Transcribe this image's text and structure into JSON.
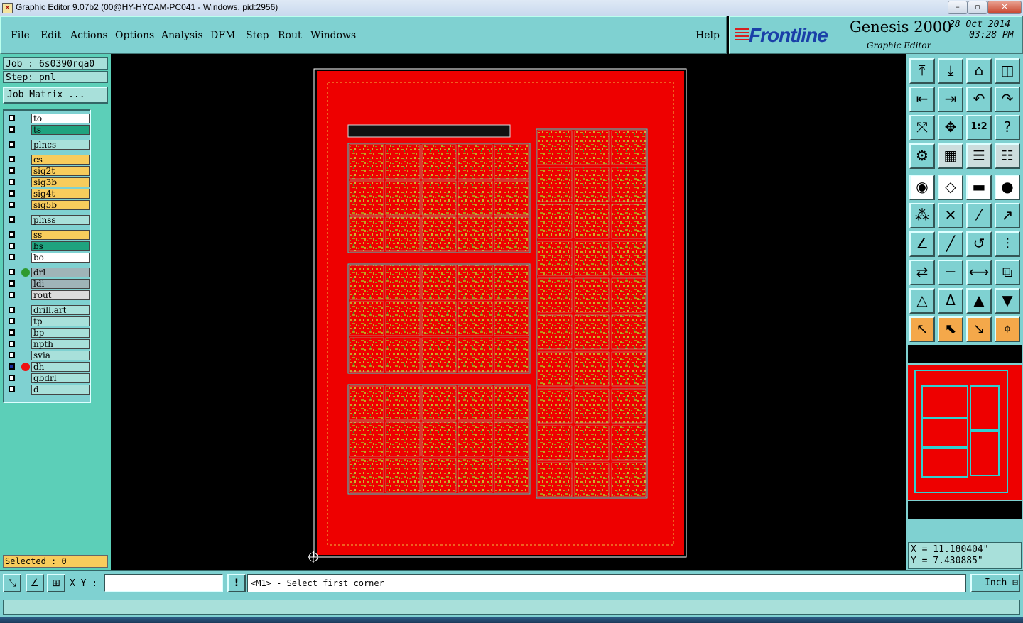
{
  "window": {
    "title": "Graphic Editor 9.07b2 (00@HY-HYCAM-PC041 - Windows, pid:2956)",
    "icon": "app-icon"
  },
  "menu": [
    "File",
    "Edit",
    "Actions",
    "Options",
    "Analysis",
    "DFM",
    "Step",
    "Rout",
    "Windows"
  ],
  "help": "Help",
  "brand": {
    "logo": "Frontline",
    "product": "Genesis 2000",
    "subtitle": "Graphic Editor",
    "date": "28 Oct 2014",
    "time": "03:28 PM"
  },
  "job": {
    "job_line": "Job : 6s0390rqa0",
    "step_line": "Step: pnl",
    "matrix_button": "Job Matrix ..."
  },
  "layers": [
    {
      "name": "to",
      "color": "#ffffff"
    },
    {
      "name": "ts",
      "color": "#1fa37f"
    },
    {
      "name": "plncs",
      "color": "#a8e0da"
    },
    {
      "name": "cs",
      "color": "#f8cc5c"
    },
    {
      "name": "sig2t",
      "color": "#f8cc5c"
    },
    {
      "name": "sig3b",
      "color": "#f8cc5c"
    },
    {
      "name": "sig4t",
      "color": "#f8cc5c"
    },
    {
      "name": "sig5b",
      "color": "#f8cc5c"
    },
    {
      "name": "plnss",
      "color": "#a8e0da"
    },
    {
      "name": "ss",
      "color": "#f8cc5c"
    },
    {
      "name": "bs",
      "color": "#1fa37f"
    },
    {
      "name": "bo",
      "color": "#ffffff"
    },
    {
      "name": "drl",
      "color": "#9fb4b8",
      "dot": "#2f9a2f"
    },
    {
      "name": "ldi",
      "color": "#9fb4b8"
    },
    {
      "name": "rout",
      "color": "#dcdcdc"
    },
    {
      "name": "drill.art",
      "color": "#a8e0da"
    },
    {
      "name": "tp",
      "color": "#a8e0da"
    },
    {
      "name": "bp",
      "color": "#a8e0da"
    },
    {
      "name": "npth",
      "color": "#a8e0da"
    },
    {
      "name": "svia",
      "color": "#a8e0da"
    },
    {
      "name": "dh",
      "color": "#a8e0da",
      "dot": "#ee1111"
    },
    {
      "name": "gbdrl",
      "color": "#a8e0da"
    },
    {
      "name": "d",
      "color": "#a8e0da"
    }
  ],
  "selected": "Selected : 0",
  "coords": {
    "x": "X = 11.180404\"",
    "y": "Y = 7.430885\""
  },
  "bottom": {
    "xy_label": "X Y :",
    "xy_value": "",
    "bang": "!",
    "status": "<M1> - Select first corner",
    "unit": "Inch"
  },
  "colors": {
    "panel": "#7fd1d1",
    "board": "#ee0000",
    "step_outline": "#30d0d0",
    "highlight": "#f8cc5c"
  },
  "tools": [
    "open-icon",
    "save-icon",
    "home-icon",
    "window-icon",
    "import-icon",
    "export-icon",
    "undo-icon",
    "redo-icon",
    "zoom-fit-icon",
    "zoom-home-icon",
    "scale-1-2-icon",
    "help-icon",
    "settings-icon",
    "grid-icon",
    "layers-icon",
    "layers-alt-icon",
    "pad-icon",
    "line-icon",
    "ruler-icon",
    "circle-icon",
    "node-icon",
    "cross-icon",
    "segment-icon",
    "arrow-icon",
    "angle-icon",
    "slash-icon",
    "arc-icon",
    "mirror-icon",
    "move-icon",
    "dash-icon",
    "measure-icon",
    "copy-icon",
    "triangle-icon",
    "triangle-a-icon",
    "triangle-up-icon",
    "triangle-down-icon",
    "pointer-icon",
    "select-icon",
    "select-alt-icon",
    "route-icon"
  ]
}
